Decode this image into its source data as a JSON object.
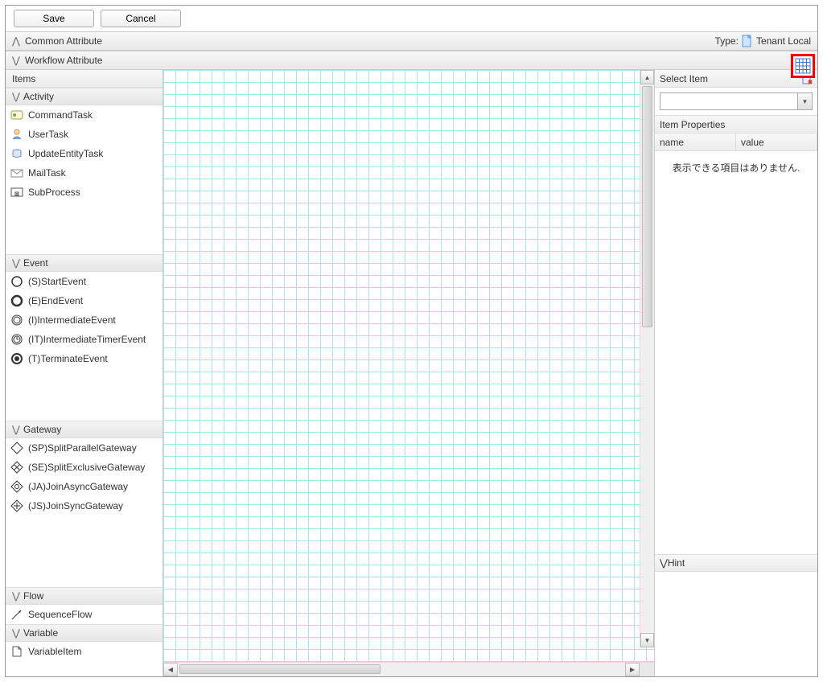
{
  "toolbar": {
    "save": "Save",
    "cancel": "Cancel"
  },
  "sections": {
    "common": "Common Attribute",
    "workflow": "Workflow Attribute",
    "type_label": "Type:",
    "type_value": "Tenant Local"
  },
  "left": {
    "items_header": "Items",
    "categories": {
      "activity": "Activity",
      "event": "Event",
      "gateway": "Gateway",
      "flow": "Flow",
      "variable": "Variable"
    },
    "activity": [
      "CommandTask",
      "UserTask",
      "UpdateEntityTask",
      "MailTask",
      "SubProcess"
    ],
    "event": [
      "(S)StartEvent",
      "(E)EndEvent",
      "(I)IntermediateEvent",
      "(IT)IntermediateTimerEvent",
      "(T)TerminateEvent"
    ],
    "gateway": [
      "(SP)SplitParallelGateway",
      "(SE)SplitExclusiveGateway",
      "(JA)JoinAsyncGateway",
      "(JS)JoinSyncGateway"
    ],
    "flow": [
      "SequenceFlow"
    ],
    "variable": [
      "VariableItem"
    ]
  },
  "right": {
    "select_item": "Select Item",
    "item_properties": "Item Properties",
    "col_name": "name",
    "col_value": "value",
    "empty_msg": "表示できる項目はありません.",
    "hint": "Hint"
  }
}
